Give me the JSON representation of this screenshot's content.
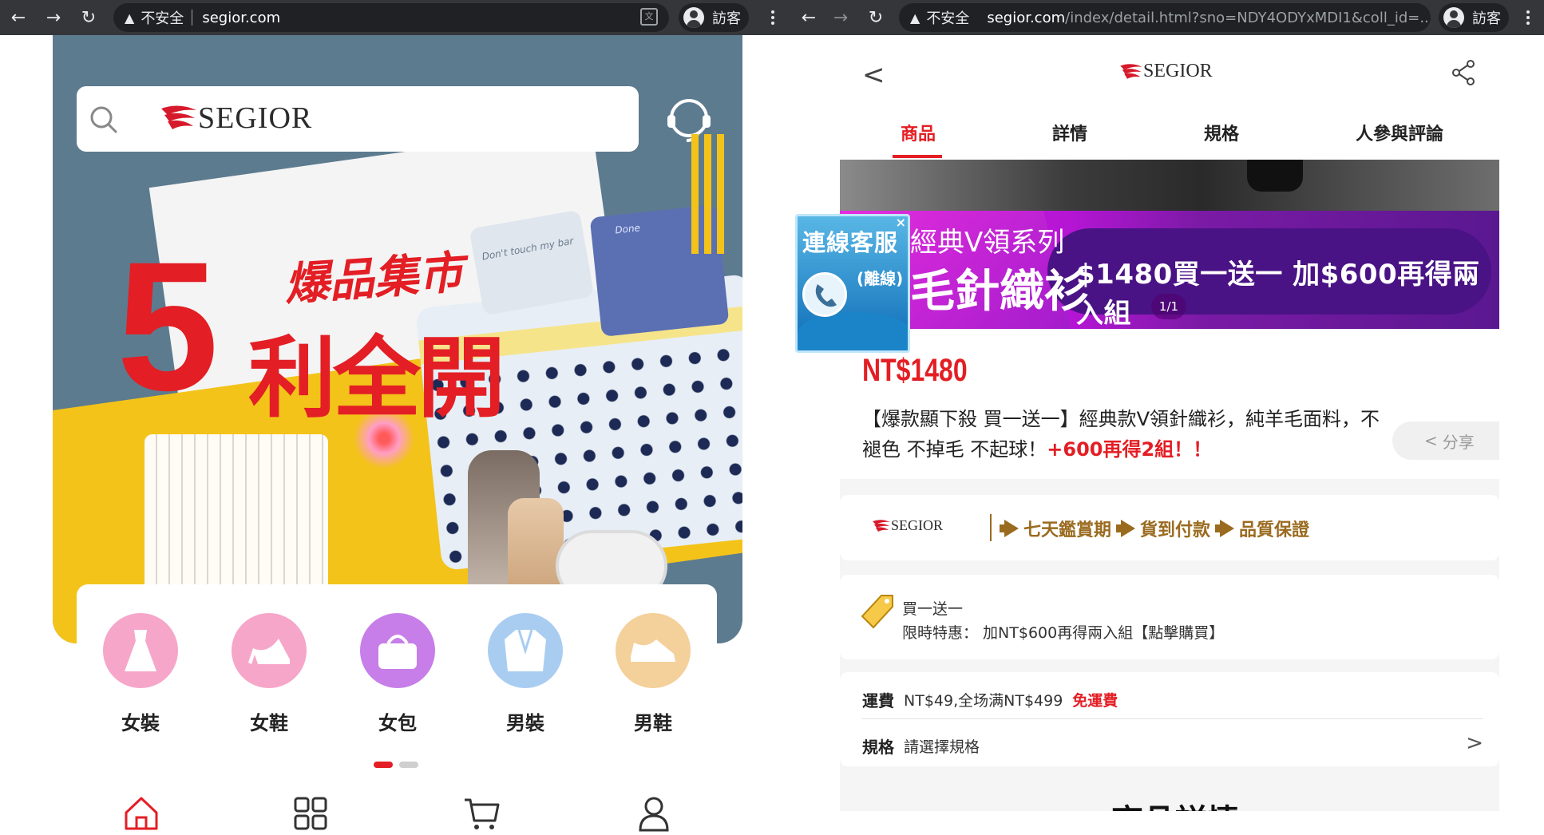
{
  "left_browser": {
    "url_warning": "不安全",
    "url_host": "segior.com",
    "url_path": "",
    "guest_label": "訪客"
  },
  "right_browser": {
    "url_warning": "不安全",
    "url_host": "segior.com",
    "url_path": "/index/detail.html?sno=NDY4ODYxMDI1&coll_id=...",
    "guest_label": "訪客"
  },
  "home": {
    "brand": "SEGIOR",
    "hero": {
      "headline_small": "爆品集市",
      "headline_number": "5",
      "headline_big": "利全開",
      "pillow_text_1": "Don't touch my bar",
      "pillow_text_2": "Done"
    },
    "categories": [
      {
        "label": "女裝",
        "icon": "dress-icon",
        "color": "#f6a6c9"
      },
      {
        "label": "女鞋",
        "icon": "high-heel-icon",
        "color": "#f6a6c9"
      },
      {
        "label": "女包",
        "icon": "handbag-icon",
        "color": "#c77ee8"
      },
      {
        "label": "男裝",
        "icon": "suit-icon",
        "color": "#a9cdf1"
      },
      {
        "label": "男鞋",
        "icon": "mens-shoe-icon",
        "color": "#f4d09a"
      }
    ],
    "tabbar": [
      "home-icon",
      "grid-icon",
      "cart-icon",
      "profile-icon"
    ]
  },
  "detail": {
    "brand": "SEGIOR",
    "tabs": [
      "商品",
      "詳情",
      "規格",
      "人參與評論"
    ],
    "active_tab": "商品",
    "banner": {
      "line1": "經典V領系列",
      "line2": "毛針織衫",
      "offer": "$1480買一送一  加$600再得兩入組",
      "pager": "1/1"
    },
    "customer_service": {
      "title": "連線客服",
      "status": "(離線)"
    },
    "price": "NT$1480",
    "title_main": "【爆款顯下殺 買一送一】經典款V領針織衫，純羊毛面料，不褪色 不掉毛 不起球！",
    "title_highlight": "+600再得2組！！",
    "share_label": "分享",
    "guarantee_brand": "SEGIOR",
    "guarantees": [
      "七天鑑賞期",
      "貨到付款",
      "品質保證"
    ],
    "promo": {
      "line1": "買一送一",
      "line2": "限時特惠： 加NT$600再得兩入組【點擊購買】"
    },
    "shipping": {
      "label": "運費",
      "value": "NT$49,全场满NT$499",
      "free": "免運費"
    },
    "spec": {
      "label": "規格",
      "value": "請選擇規格"
    },
    "section_heading": "商品詳情"
  },
  "colors": {
    "accent": "#e31e24",
    "chrome_bg": "#35363a",
    "omnibox_bg": "#202124",
    "guarantee_gold": "#9a6b1f"
  }
}
